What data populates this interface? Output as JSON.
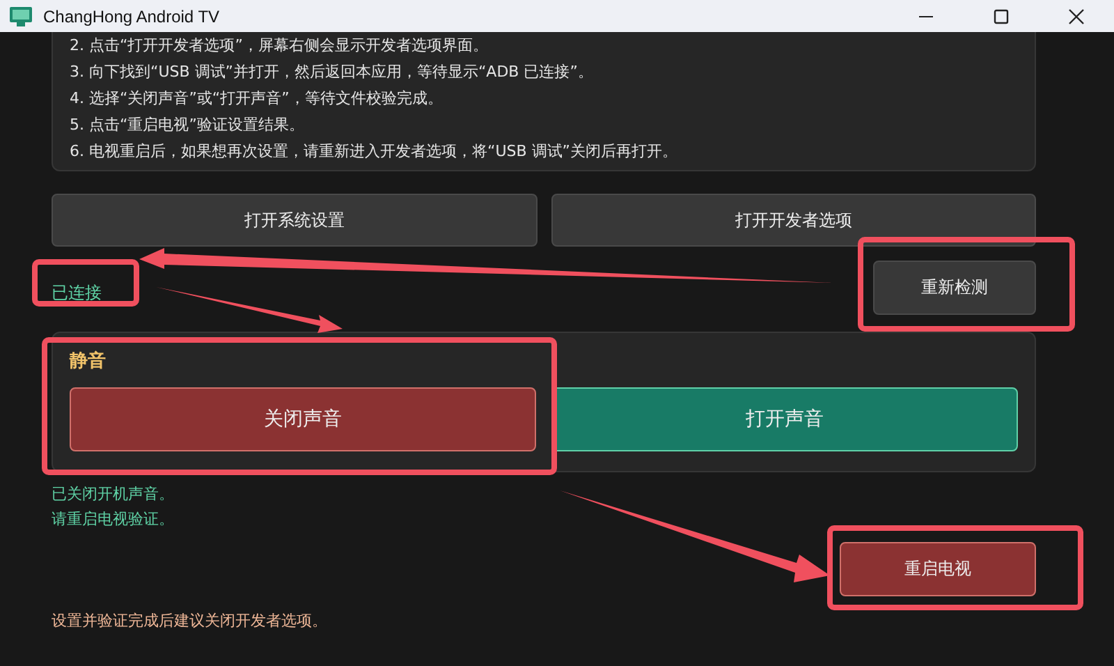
{
  "window": {
    "title": "ChangHong Android TV"
  },
  "instructions": [
    "2. 点击“打开开发者选项”，屏幕右侧会显示开发者选项界面。",
    "3. 向下找到“USB 调试”并打开，然后返回本应用，等待显示“ADB 已连接”。",
    "4. 选择“关闭声音”或“打开声音”，等待文件校验完成。",
    "5. 点击“重启电视”验证设置结果。",
    "6. 电视重启后，如果想再次设置，请重新进入开发者选项，将“USB 调试”关闭后再打开。"
  ],
  "buttons": [
    "打开系统设置",
    "打开开发者选项"
  ],
  "connection": {
    "status": "已连接",
    "connected": true
  },
  "recheck_button": "重新检测",
  "mute_panel": {
    "title": "静音",
    "buttons": [
      {
        "label": "关闭声音",
        "kind": "danger"
      },
      {
        "label": "打开声音",
        "kind": "success"
      }
    ]
  },
  "messages": [
    "已关闭开机声音。",
    "请重启电视验证。"
  ],
  "restart_button": "重启电视",
  "footer_note": "设置并验证完成后建议关闭开发者选项。"
}
